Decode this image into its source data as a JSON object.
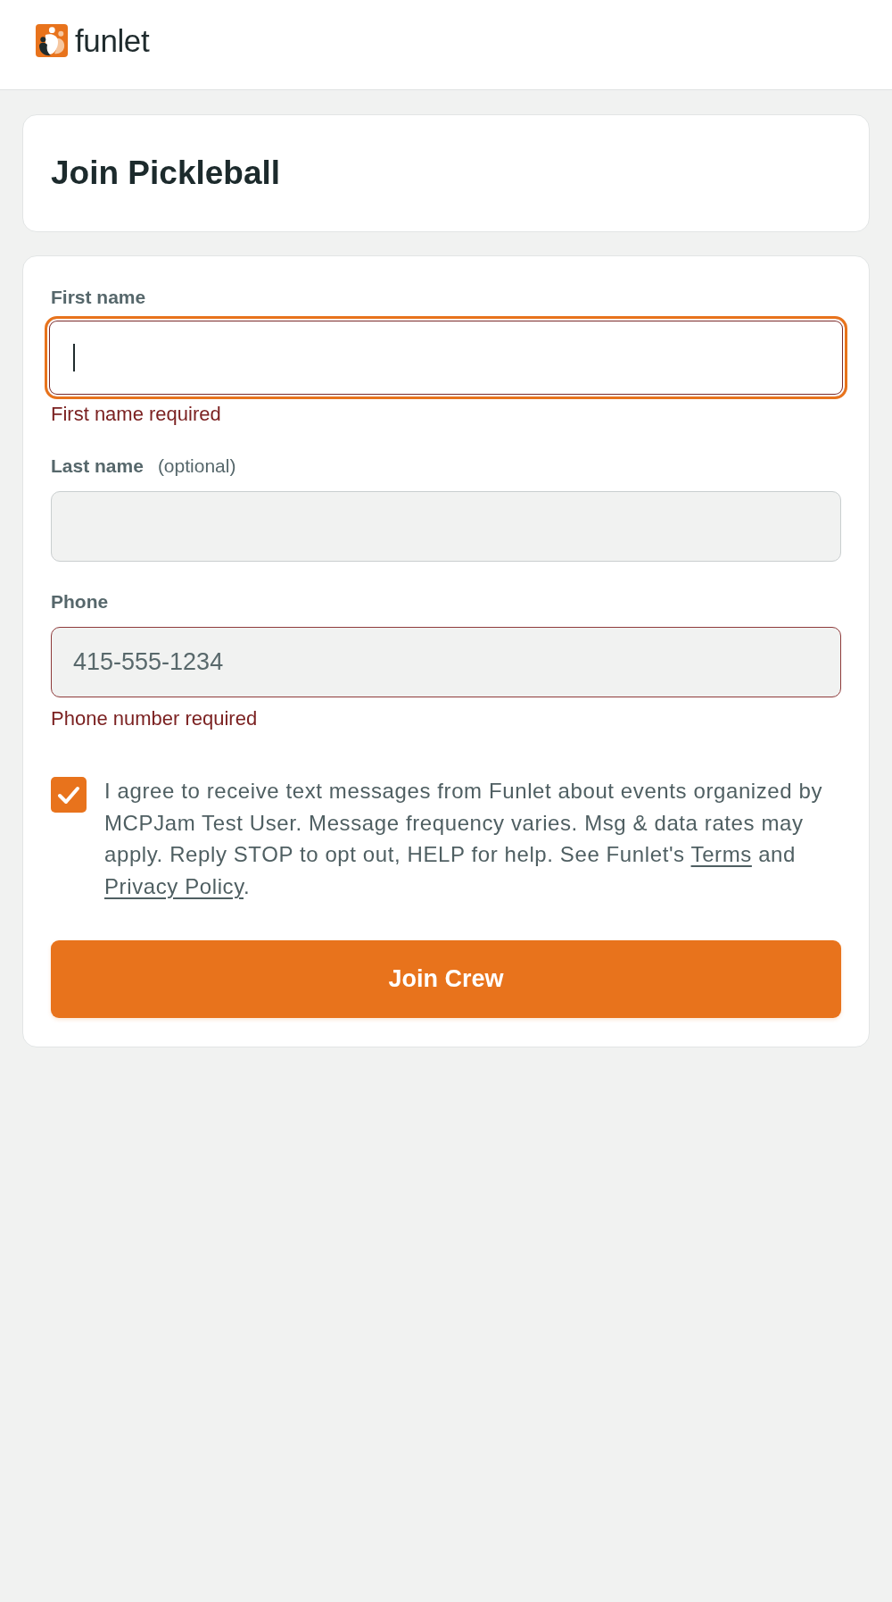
{
  "header": {
    "logo_text": "funlet"
  },
  "title": "Join Pickleball",
  "form": {
    "fields": [
      {
        "label": "First name",
        "focused": true,
        "invalid": true,
        "error": "First name required"
      },
      {
        "label": "Last name",
        "note": "(optional)",
        "focused": false,
        "invalid": false
      },
      {
        "label": "Phone",
        "placeholder": "415-555-1234",
        "focused": false,
        "invalid": true,
        "error": "Phone number required"
      }
    ],
    "consent": {
      "checked": true,
      "parts": [
        {
          "kind": "text",
          "text": "I agree to receive text messages from Funlet about events organized by MCPJam Test User. Message frequency varies. Msg & data rates may apply. Reply STOP to opt out, HELP for help. See Funlet's "
        },
        {
          "kind": "link",
          "text": "Terms"
        },
        {
          "kind": "text",
          "text": " and "
        },
        {
          "kind": "link",
          "text": "Privacy Policy"
        },
        {
          "kind": "text",
          "text": "."
        }
      ]
    },
    "submit_button": {
      "label": "Join Crew"
    }
  }
}
